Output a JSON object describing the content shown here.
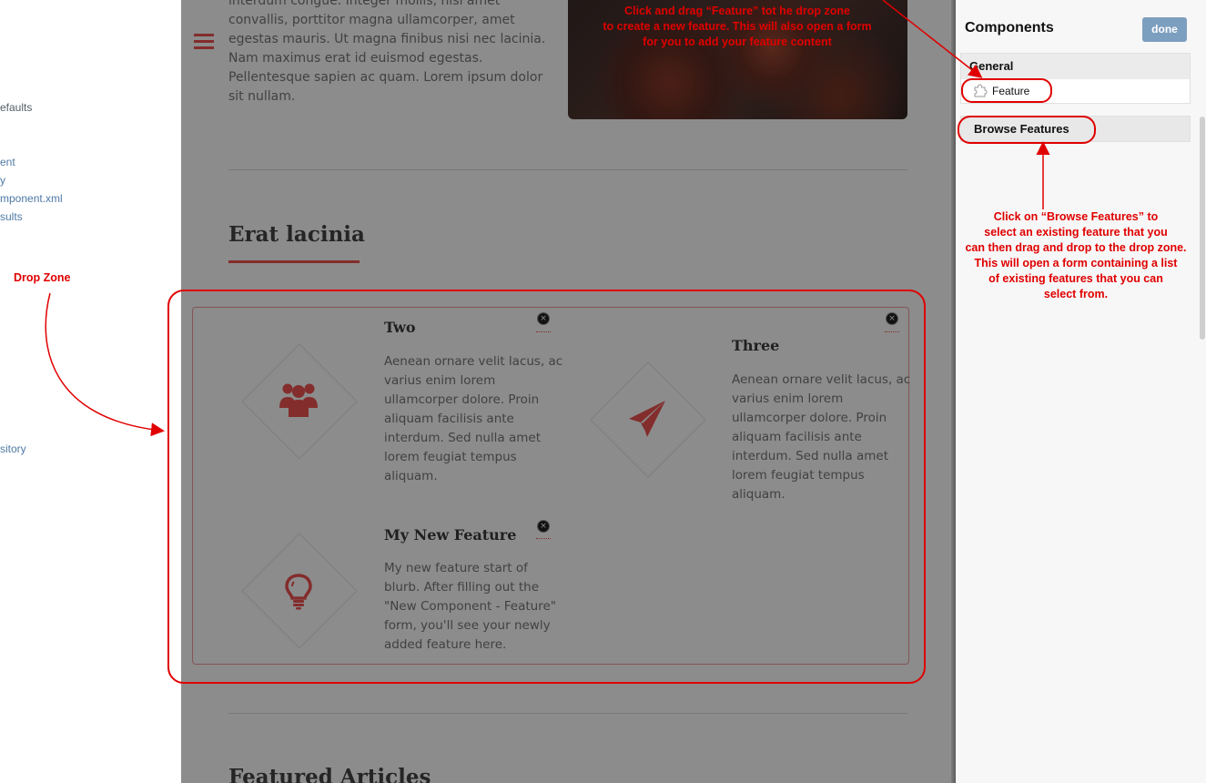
{
  "left_sidebar": {
    "items": [
      "efaults",
      "ent",
      "y",
      "mponent.xml",
      "sults",
      "sitory"
    ]
  },
  "main": {
    "top_text_lines": [
      "interdum congue. Integer mollis, nisi amet",
      "convallis, porttitor magna ullamcorper, amet",
      "egestas mauris. Ut magna finibus nisi nec lacinia.",
      "Nam maximus erat id euismod egestas.",
      "Pellentesque sapien ac quam. Lorem ipsum dolor",
      "sit nullam."
    ],
    "section_title": "Erat lacinia",
    "featured_title": "Featured Articles"
  },
  "drop_zone": {
    "features": [
      {
        "title": "Two",
        "icon": "users-icon",
        "body_lines": [
          "Aenean ornare velit lacus, ac",
          "varius enim lorem",
          "ullamcorper dolore. Proin",
          "aliquam facilisis ante",
          "interdum. Sed nulla amet",
          "lorem feugiat tempus",
          "aliquam."
        ]
      },
      {
        "title": "Three",
        "icon": "paper-plane-icon",
        "body_lines": [
          "Aenean ornare velit lacus, ac",
          "varius enim lorem",
          "ullamcorper dolore. Proin",
          "aliquam facilisis ante",
          "interdum. Sed nulla amet",
          "lorem feugiat tempus",
          "aliquam."
        ]
      },
      {
        "title": "My New Feature",
        "icon": "lightbulb-icon",
        "body_lines": [
          "My new feature start of",
          "blurb.  After filling out the",
          "\"New Component - Feature\"",
          "form, you'll see your newly",
          "added feature here."
        ]
      }
    ],
    "remove_glyph": "×"
  },
  "components_panel": {
    "title": "Components",
    "done_label": "done",
    "general_label": "General",
    "feature_item_label": "Feature",
    "feature_item_icon": "puzzle-icon",
    "browse_label": "Browse Features"
  },
  "annotations": {
    "drag_feature_lines": [
      "Click and drag “Feature” tot he drop zone",
      "to create a new feature. This will also open a form",
      "for you to add your feature content"
    ],
    "drop_zone_label": "Drop Zone",
    "browse_lines": [
      "Click on “Browse Features” to",
      "select an existing feature that you",
      "can then drag and drop to the drop zone.",
      "This will open a form containing a list",
      "of existing features that you can",
      "select from."
    ]
  },
  "colors": {
    "accent": "#ef5350",
    "annotation": "#e00000",
    "done_button": "#7d9fbf"
  }
}
